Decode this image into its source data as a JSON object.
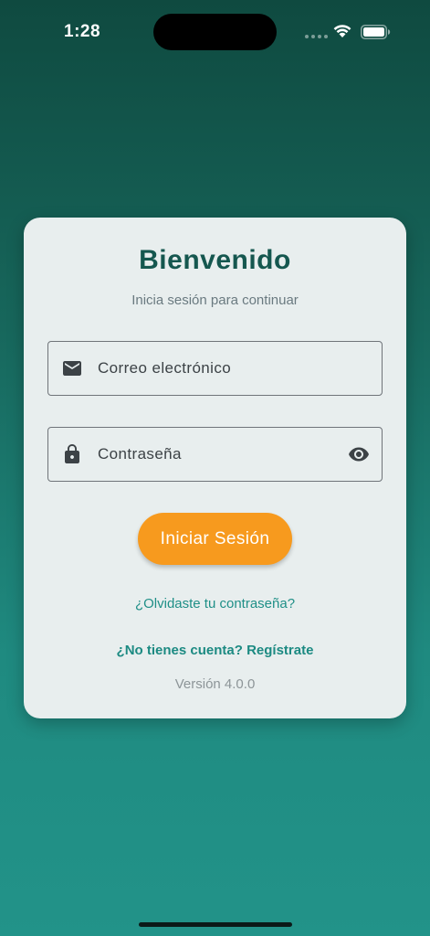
{
  "status_bar": {
    "time": "1:28",
    "icons": [
      "signal-dots-icon",
      "wifi-icon",
      "battery-icon"
    ]
  },
  "login_card": {
    "title": "Bienvenido",
    "subtitle": "Inicia sesión para continuar",
    "email_field": {
      "placeholder": "Correo electrónico",
      "value": "",
      "icon": "mail-icon"
    },
    "password_field": {
      "placeholder": "Contraseña",
      "value": "",
      "icon": "lock-icon",
      "trailing_icon": "eye-icon"
    },
    "login_button": "Iniciar Sesión",
    "forgot_password": "¿Olvidaste tu contraseña?",
    "register": "¿No tienes cuenta? Regístrate",
    "version": "Versión 4.0.0"
  },
  "colors": {
    "primary": "#15574f",
    "accent": "#f79a1e",
    "link": "#1f8f87",
    "background_top": "#0f4a40",
    "background_bottom": "#229389",
    "card": "#e8eeee"
  }
}
